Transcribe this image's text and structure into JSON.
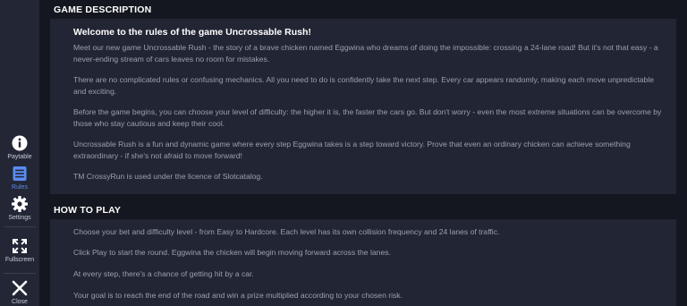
{
  "sidebar": {
    "items": [
      {
        "label": "Paytable",
        "icon": "info-icon",
        "active": false
      },
      {
        "label": "Rules",
        "icon": "list-icon",
        "active": true
      },
      {
        "label": "Settings",
        "icon": "gear-icon",
        "active": false
      },
      {
        "label": "Fullscreen",
        "icon": "fullscreen-icon",
        "active": false
      },
      {
        "label": "Close",
        "icon": "close-icon",
        "active": false
      }
    ]
  },
  "game_description": {
    "title": "GAME DESCRIPTION",
    "heading": "Welcome to the rules of the game Uncrossable Rush!",
    "paragraphs": [
      "Meet our new game Uncrossable Rush - the story of a brave chicken named Eggwina who dreams of doing the impossible: crossing a 24-lane road! But it's not that easy - a never-ending stream of cars leaves no room for mistakes.",
      "There are no complicated rules or confusing mechanics. All you need to do is confidently take the next step. Every car appears randomly, making each move unpredictable and exciting.",
      "Before the game begins, you can choose your level of difficulty: the higher it is, the faster the cars go. But don't worry - even the most extreme situations can be overcome by those who stay cautious and keep their cool.",
      "Uncrossable Rush is a fun and dynamic game where every step Eggwina takes is a step toward victory. Prove that even an ordinary chicken can achieve something extraordinary - if she's not afraid to move forward!",
      "TM CrossyRun is used under the licence of Slotcatalog."
    ]
  },
  "how_to_play": {
    "title": "HOW TO PLAY",
    "paragraphs": [
      "Choose your bet and difficulty level - from Easy to Hardcore. Each level has its own collision frequency and 24 lanes of traffic.",
      "Click Play to start the round. Eggwina the chicken will begin moving forward across the lanes.",
      "At every step, there's a chance of getting hit by a car.",
      "Your goal is to reach the end of the road and win a prize multiplied according to your chosen risk."
    ]
  },
  "colors": {
    "background": "#14171f",
    "sidebar": "#232735",
    "panel": "#222634",
    "accent": "#5a8cf0",
    "text_muted": "#9aa0ad"
  }
}
